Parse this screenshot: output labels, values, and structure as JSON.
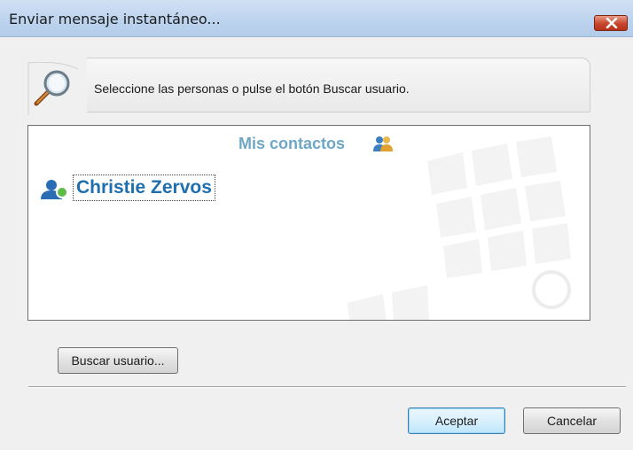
{
  "window": {
    "title": "Enviar mensaje instantáneo...",
    "close_icon": "close-icon"
  },
  "banner": {
    "icon": "magnifier-icon",
    "text": "Seleccione las personas o pulse el botón Buscar usuario."
  },
  "contacts": {
    "heading": "Mis contactos",
    "heading_icon": "contacts-group-icon",
    "items": [
      {
        "name": "Christie Zervos",
        "icon": "user-online-icon",
        "status_color": "#5dbb46"
      }
    ]
  },
  "buttons": {
    "search_user": "Buscar usuario...",
    "accept": "Aceptar",
    "cancel": "Cancelar"
  },
  "colors": {
    "title_bar": "#bcd3ee",
    "accent_link": "#1f6fae",
    "heading": "#6ea7c6",
    "close": "#c7452d"
  }
}
